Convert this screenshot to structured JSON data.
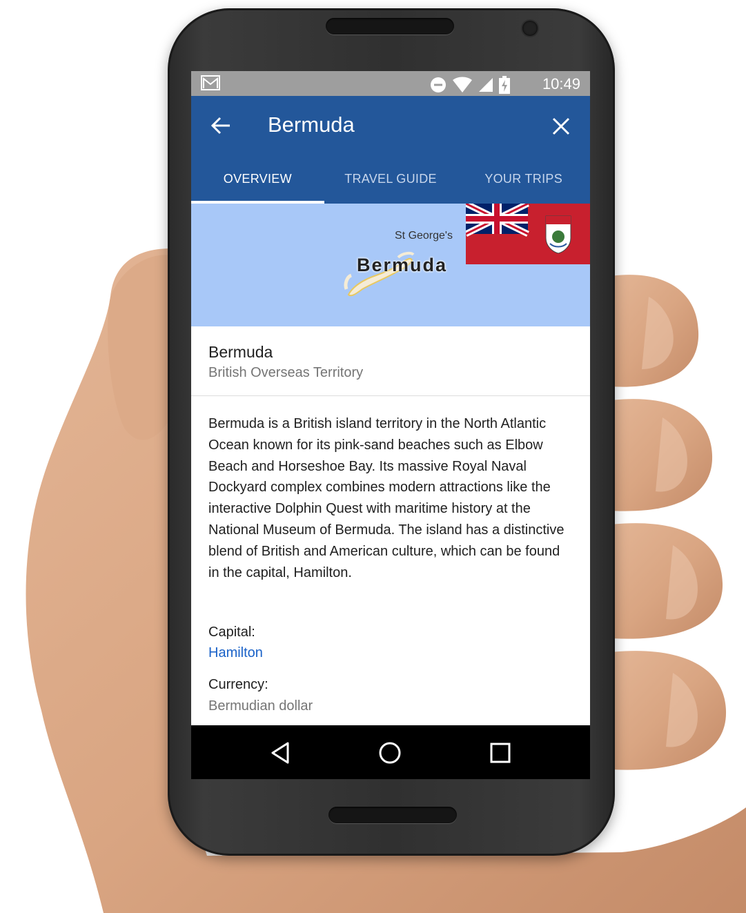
{
  "status": {
    "time": "10:49",
    "icons": [
      "gmail-icon",
      "do-not-disturb-icon",
      "wifi-icon",
      "cell-signal-icon",
      "battery-charging-icon"
    ]
  },
  "appbar": {
    "title": "Bermuda"
  },
  "tabs": [
    {
      "label": "OVERVIEW",
      "active": true
    },
    {
      "label": "TRAVEL GUIDE",
      "active": false
    },
    {
      "label": "YOUR TRIPS",
      "active": false
    }
  ],
  "map": {
    "town_label": "St George's",
    "island_label": "Bermuda"
  },
  "place": {
    "name": "Bermuda",
    "type": "British Overseas Territory",
    "description": "Bermuda is a British island territory in the North Atlantic Ocean known for its pink-sand beaches such as Elbow Beach and Horseshoe Bay. Its massive Royal Naval Dockyard complex combines modern attractions like the interactive Dolphin Quest with maritime history at the National Museum of Bermuda. The island has a distinctive blend of British and American culture, which can be found in the capital, Hamilton.",
    "capital_label": "Capital:",
    "capital_value": "Hamilton",
    "currency_label": "Currency:",
    "currency_value": "Bermudian dollar"
  },
  "colors": {
    "appbar": "#23579a",
    "status_bar": "#9e9e9e",
    "link": "#1a62c8",
    "map_water": "#a8c8f8",
    "flag_red": "#c8202e"
  },
  "navbar": {
    "buttons": [
      "back-triangle-icon",
      "home-circle-icon",
      "recents-square-icon"
    ]
  }
}
